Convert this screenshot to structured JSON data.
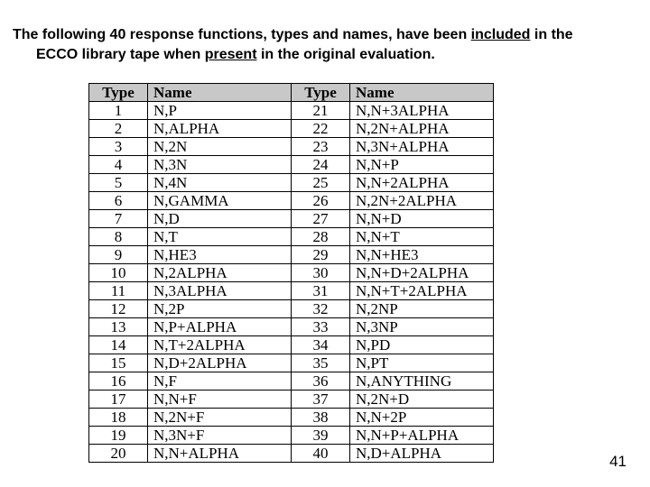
{
  "intro": {
    "line1_a": "The following 40 response functions, types and names, have been ",
    "line1_b": "included",
    "line1_c": " in the",
    "line2_a": "ECCO library tape when ",
    "line2_b": "present",
    "line2_c": " in the original evaluation."
  },
  "headers": {
    "type": "Type",
    "name": "Name"
  },
  "rows": [
    {
      "t1": "1",
      "n1": "N,P",
      "t2": "21",
      "n2": "N,N+3ALPHA"
    },
    {
      "t1": "2",
      "n1": "N,ALPHA",
      "t2": "22",
      "n2": "N,2N+ALPHA"
    },
    {
      "t1": "3",
      "n1": "N,2N",
      "t2": "23",
      "n2": "N,3N+ALPHA"
    },
    {
      "t1": "4",
      "n1": "N,3N",
      "t2": "24",
      "n2": "N,N+P"
    },
    {
      "t1": "5",
      "n1": "N,4N",
      "t2": "25",
      "n2": "N,N+2ALPHA"
    },
    {
      "t1": "6",
      "n1": "N,GAMMA",
      "t2": "26",
      "n2": "N,2N+2ALPHA"
    },
    {
      "t1": "7",
      "n1": "N,D",
      "t2": "27",
      "n2": "N,N+D"
    },
    {
      "t1": "8",
      "n1": "N,T",
      "t2": "28",
      "n2": "N,N+T"
    },
    {
      "t1": "9",
      "n1": "N,HE3",
      "t2": "29",
      "n2": "N,N+HE3"
    },
    {
      "t1": "10",
      "n1": "N,2ALPHA",
      "t2": "30",
      "n2": "N,N+D+2ALPHA"
    },
    {
      "t1": "11",
      "n1": "N,3ALPHA",
      "t2": "31",
      "n2": "N,N+T+2ALPHA"
    },
    {
      "t1": "12",
      "n1": "N,2P",
      "t2": "32",
      "n2": "N,2NP"
    },
    {
      "t1": "13",
      "n1": "N,P+ALPHA",
      "t2": "33",
      "n2": "N,3NP"
    },
    {
      "t1": "14",
      "n1": "N,T+2ALPHA",
      "t2": "34",
      "n2": "N,PD"
    },
    {
      "t1": "15",
      "n1": "N,D+2ALPHA",
      "t2": "35",
      "n2": "N,PT"
    },
    {
      "t1": "16",
      "n1": "N,F",
      "t2": "36",
      "n2": "N,ANYTHING"
    },
    {
      "t1": "17",
      "n1": "N,N+F",
      "t2": "37",
      "n2": "N,2N+D"
    },
    {
      "t1": "18",
      "n1": "N,2N+F",
      "t2": "38",
      "n2": "N,N+2P"
    },
    {
      "t1": "19",
      "n1": "N,3N+F",
      "t2": "39",
      "n2": "N,N+P+ALPHA"
    },
    {
      "t1": "20",
      "n1": "N,N+ALPHA",
      "t2": "40",
      "n2": "N,D+ALPHA"
    }
  ],
  "page_number": "41"
}
